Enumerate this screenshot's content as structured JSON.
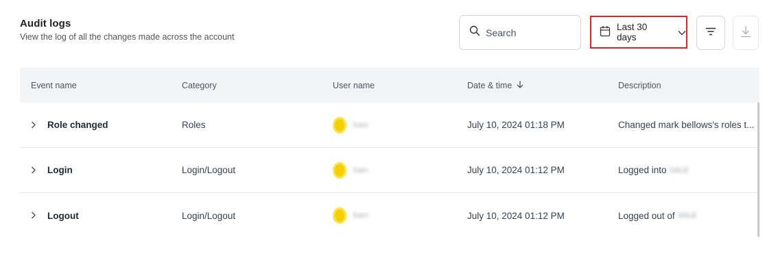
{
  "header": {
    "title": "Audit logs",
    "subtitle": "View the log of all the changes made across the account"
  },
  "search": {
    "placeholder": "Search",
    "value": ""
  },
  "date_filter": {
    "label": "Last 30 days"
  },
  "table": {
    "columns": [
      "Event name",
      "Category",
      "User name",
      "Date & time",
      "Description"
    ],
    "sort_column": "Date & time",
    "rows": [
      {
        "event": "Role changed",
        "category": "Roles",
        "user": "Sam",
        "datetime": "July 10, 2024 01:18 PM",
        "description": "Changed mark bellows's roles t...",
        "desc_redacted": ""
      },
      {
        "event": "Login",
        "category": "Login/Logout",
        "user": "Sam",
        "datetime": "July 10, 2024 01:12 PM",
        "description": "Logged into",
        "desc_redacted": "SALE"
      },
      {
        "event": "Logout",
        "category": "Login/Logout",
        "user": "Sam",
        "datetime": "July 10, 2024 01:12 PM",
        "description": "Logged out of",
        "desc_redacted": "SALE"
      }
    ]
  },
  "colors": {
    "highlight_border": "#e02424",
    "avatar": "#f5d000",
    "header_bg": "#f3f4f6"
  },
  "icons": [
    "search-icon",
    "calendar-icon",
    "chevron-down-icon",
    "filter-icon",
    "download-icon",
    "sort-arrow-down-icon",
    "chevron-right-icon"
  ]
}
